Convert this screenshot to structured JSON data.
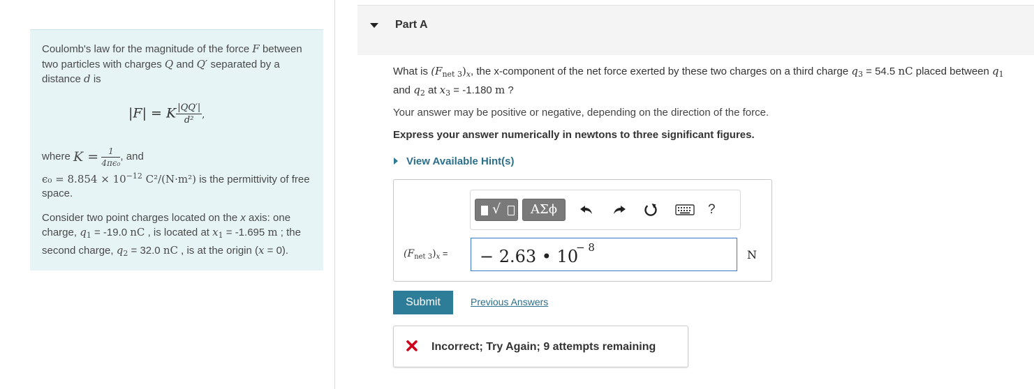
{
  "left_panel": {
    "intro_prefix": "Coulomb's law for the magnitude of the force ",
    "intro_var_f": "F",
    "intro_mid": " between two particles with charges ",
    "intro_var_q": "Q",
    "intro_and": " and ",
    "intro_var_qp": "Q′",
    "intro_sep": " separated by a distance ",
    "intro_var_d": "d",
    "intro_is": " is",
    "formula_lhs": "|F| = K",
    "formula_num": "|QQ′|",
    "formula_den": "d²",
    "formula_tail": ",",
    "where_text": "where ",
    "k_symbol": "K =",
    "k_num": "1",
    "k_den": "4πϵ₀",
    "k_and": ", and",
    "eps_expr": "ϵ₀ = 8.854 × 10",
    "eps_exp": "−12",
    "eps_units": " C²/(N·m²)",
    "eps_tail": " is the permittivity of free space.",
    "consider_1": "Consider two point charges located on the ",
    "consider_x": "x",
    "consider_2": " axis: one charge, ",
    "q1_sym": "q",
    "q1_sub": "1",
    "q1_eq": " = -19.0 ",
    "q1_unit": "nC",
    "consider_3": " , is located at ",
    "x1_sym": "x",
    "x1_sub": "1",
    "x1_eq": " = -1.695 ",
    "x1_unit": "m",
    "consider_4": " ; the second charge, ",
    "q2_sym": "q",
    "q2_sub": "2",
    "q2_eq": " = 32.0 ",
    "q2_unit": "nC",
    "consider_5": " , is at the origin (",
    "origin_x": "x",
    "consider_6": " = 0)."
  },
  "part": {
    "title": "Part A"
  },
  "question": {
    "q_prefix": "What is ",
    "f_sym": "(F",
    "f_sub": "net 3",
    "f_close": ")",
    "f_x": "x",
    "q_mid": ", the x-component of the net force exerted by these two charges on a third charge ",
    "q3_sym": "q",
    "q3_sub": "3",
    "q3_eq": " = 54.5 ",
    "q3_unit": "nC",
    "q_placed": " placed between ",
    "qa": "q",
    "qa_sub": "1",
    "q_and": " and ",
    "qb": "q",
    "qb_sub": "2",
    "q_at": " at ",
    "x3_sym": "x",
    "x3_sub": "3",
    "x3_eq": " = -1.180 ",
    "x3_unit": "m",
    "q_end": " ?",
    "answer_note": "Your answer may be positive or negative, depending on the direction of the force.",
    "express": "Express your answer numerically in newtons to three significant figures.",
    "hint_label": "View Available Hint(s)"
  },
  "answer": {
    "toolbar_symbols": "ΑΣϕ",
    "toolbar_help": "?",
    "label_f": "(F",
    "label_sub": "net 3",
    "label_close": ")",
    "label_x": "x",
    "label_eq": " =",
    "value_main": "− 2.63 • 10",
    "value_exp": "− 8",
    "unit": "N"
  },
  "actions": {
    "submit_label": "Submit",
    "previous_label": "Previous Answers"
  },
  "feedback": {
    "text": "Incorrect; Try Again; 9 attempts remaining",
    "icon_color": "#d0021b"
  },
  "colors": {
    "accent": "#2d7d98",
    "panel_bg": "#e6f4f6",
    "input_border": "#3a7bc8"
  }
}
